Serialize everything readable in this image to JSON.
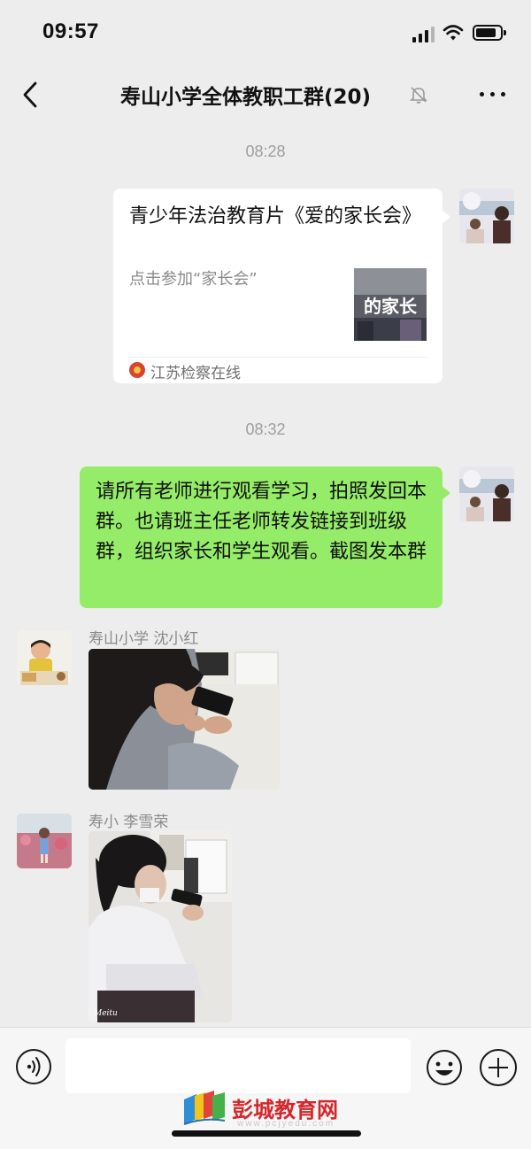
{
  "status_bar": {
    "time": "09:57"
  },
  "header": {
    "title": "寿山小学全体教职工群(20)"
  },
  "messages": [
    {
      "timestamp": "08:28",
      "type": "link",
      "title": "青少年法治教育片《爱的家长会》",
      "description": "点击参加“家长会”",
      "thumbnail_text": "的家长",
      "source": "江苏检察在线"
    },
    {
      "timestamp": "08:32",
      "type": "text",
      "text": "请所有老师进行观看学习，拍照发回本群。也请班主任老师转发链接到班级群，组织家长和学生观看。截图发本群"
    },
    {
      "type": "image",
      "sender": "寿山小学 沈小红"
    },
    {
      "type": "image",
      "sender": "寿小 李雪荣",
      "photo_watermark": "Meitu"
    }
  ],
  "input_bar": {
    "placeholder": ""
  },
  "watermark": {
    "site_name": "彭城教育网",
    "url": "www.pcjyedu.com"
  },
  "colors": {
    "background": "#ededed",
    "self_bubble": "#95ec69",
    "other_bubble": "#ffffff",
    "brand_red": "#d4262b"
  },
  "icons": [
    "back-icon",
    "mute-bell-icon",
    "more-icon",
    "voice-icon",
    "emoji-icon",
    "plus-icon"
  ]
}
